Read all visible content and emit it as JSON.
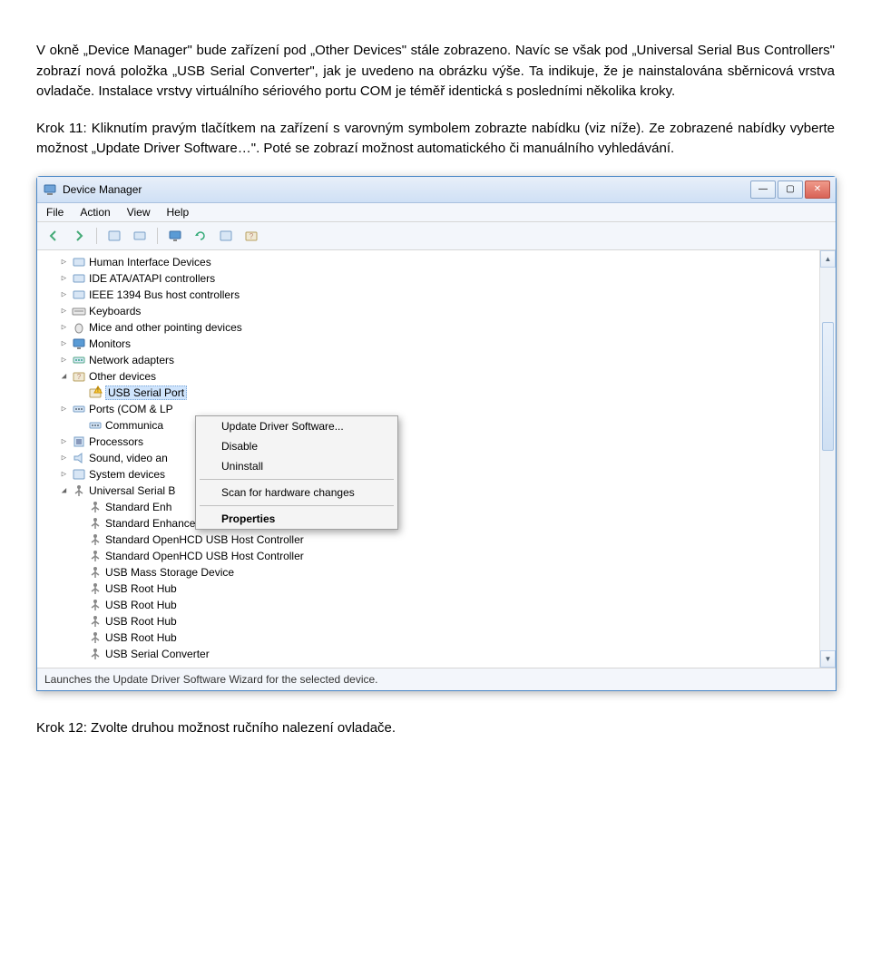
{
  "doc": {
    "p1": "V okně „Device Manager\" bude zařízení pod „Other Devices\" stále zobrazeno. Navíc se však pod „Universal Serial Bus Controllers\" zobrazí nová položka „USB Serial Converter\", jak je uvedeno na obrázku výše. Ta indikuje, že je nainstalována sběrnicová vrstva ovladače. Instalace vrstvy virtuálního sériového portu COM je téměř identická s posledními několika kroky.",
    "p2": "Krok 11: Kliknutím pravým tlačítkem na zařízení s varovným symbolem zobrazte nabídku (viz níže). Ze zobrazené nabídky vyberte možnost „Update Driver Software…\". Poté se zobrazí možnost automatického či manuálního vyhledávání.",
    "p3": "Krok 12: Zvolte druhou možnost ručního nalezení ovladače."
  },
  "window": {
    "title": "Device Manager",
    "menu": [
      "File",
      "Action",
      "View",
      "Help"
    ],
    "status": "Launches the Update Driver Software Wizard for the selected device."
  },
  "tree": [
    {
      "level": 1,
      "exp": "▷",
      "icon": "hid",
      "label": "Human Interface Devices"
    },
    {
      "level": 1,
      "exp": "▷",
      "icon": "ide",
      "label": "IDE ATA/ATAPI controllers"
    },
    {
      "level": 1,
      "exp": "▷",
      "icon": "ieee",
      "label": "IEEE 1394 Bus host controllers"
    },
    {
      "level": 1,
      "exp": "▷",
      "icon": "kbd",
      "label": "Keyboards"
    },
    {
      "level": 1,
      "exp": "▷",
      "icon": "mouse",
      "label": "Mice and other pointing devices"
    },
    {
      "level": 1,
      "exp": "▷",
      "icon": "monitor",
      "label": "Monitors"
    },
    {
      "level": 1,
      "exp": "▷",
      "icon": "net",
      "label": "Network adapters"
    },
    {
      "level": 1,
      "exp": "◢",
      "icon": "other",
      "label": "Other devices"
    },
    {
      "level": 2,
      "exp": "",
      "icon": "warn",
      "label": "USB Serial Port",
      "selected": true
    },
    {
      "level": 1,
      "exp": "▷",
      "icon": "port",
      "label": "Ports (COM & LP"
    },
    {
      "level": 2,
      "exp": "",
      "icon": "port",
      "label": "Communica"
    },
    {
      "level": 1,
      "exp": "▷",
      "icon": "cpu",
      "label": "Processors"
    },
    {
      "level": 1,
      "exp": "▷",
      "icon": "sound",
      "label": "Sound, video an"
    },
    {
      "level": 1,
      "exp": "▷",
      "icon": "sys",
      "label": "System devices"
    },
    {
      "level": 1,
      "exp": "◢",
      "icon": "usb",
      "label": "Universal Serial B"
    },
    {
      "level": 2,
      "exp": "",
      "icon": "usb",
      "label": "Standard Enh"
    },
    {
      "level": 2,
      "exp": "",
      "icon": "usb",
      "label": "Standard Enhanced PCI to USB Host Controller"
    },
    {
      "level": 2,
      "exp": "",
      "icon": "usb",
      "label": "Standard OpenHCD USB Host Controller"
    },
    {
      "level": 2,
      "exp": "",
      "icon": "usb",
      "label": "Standard OpenHCD USB Host Controller"
    },
    {
      "level": 2,
      "exp": "",
      "icon": "usb",
      "label": "USB Mass Storage Device"
    },
    {
      "level": 2,
      "exp": "",
      "icon": "usb",
      "label": "USB Root Hub"
    },
    {
      "level": 2,
      "exp": "",
      "icon": "usb",
      "label": "USB Root Hub"
    },
    {
      "level": 2,
      "exp": "",
      "icon": "usb",
      "label": "USB Root Hub"
    },
    {
      "level": 2,
      "exp": "",
      "icon": "usb",
      "label": "USB Root Hub"
    },
    {
      "level": 2,
      "exp": "",
      "icon": "usb",
      "label": "USB Serial Converter"
    }
  ],
  "context_menu": [
    {
      "label": "Update Driver Software...",
      "type": "item"
    },
    {
      "label": "Disable",
      "type": "item"
    },
    {
      "label": "Uninstall",
      "type": "item"
    },
    {
      "type": "sep"
    },
    {
      "label": "Scan for hardware changes",
      "type": "item"
    },
    {
      "type": "sep"
    },
    {
      "label": "Properties",
      "type": "bold"
    }
  ]
}
